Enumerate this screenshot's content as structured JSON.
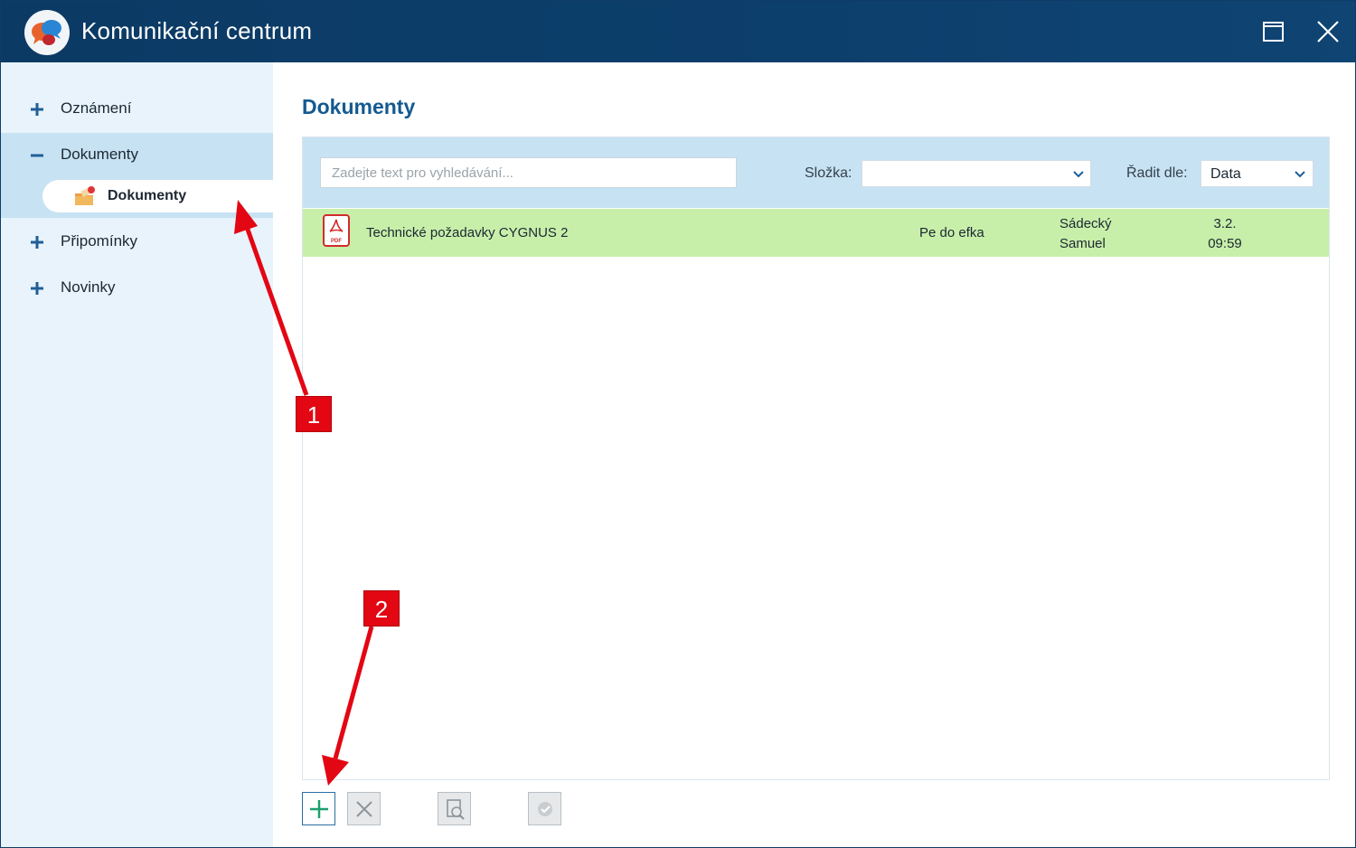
{
  "window": {
    "title": "Komunikační centrum"
  },
  "sidebar": {
    "items": [
      {
        "label": "Oznámení",
        "expanded": false
      },
      {
        "label": "Dokumenty",
        "expanded": true,
        "children": [
          {
            "label": "Dokumenty"
          }
        ]
      },
      {
        "label": "Připomínky",
        "expanded": false
      },
      {
        "label": "Novinky",
        "expanded": false
      }
    ]
  },
  "main": {
    "title": "Dokumenty",
    "search": {
      "placeholder": "Zadejte text pro vyhledávání...",
      "value": ""
    },
    "folder": {
      "label": "Složka:",
      "value": ""
    },
    "sort": {
      "label": "Řadit dle:",
      "value": "Data"
    },
    "documents": [
      {
        "name": "Technické požadavky CYGNUS 2",
        "folder": "Pe do efka",
        "author_line1": "Sádecký",
        "author_line2": "Samuel",
        "date_line1": "3.2.",
        "date_line2": "09:59"
      }
    ],
    "toolbar": [
      "add-icon",
      "delete-icon",
      "preview-icon",
      "confirm-icon"
    ]
  },
  "annotations": {
    "callout_1": "1",
    "callout_2": "2",
    "color": "#e30613"
  },
  "colors": {
    "titlebar": "#0d3f6c",
    "sidebar": "#e8f3fb",
    "selected": "#c7e2f3",
    "row_highlight": "#c8efa9",
    "heading": "#135a91"
  }
}
